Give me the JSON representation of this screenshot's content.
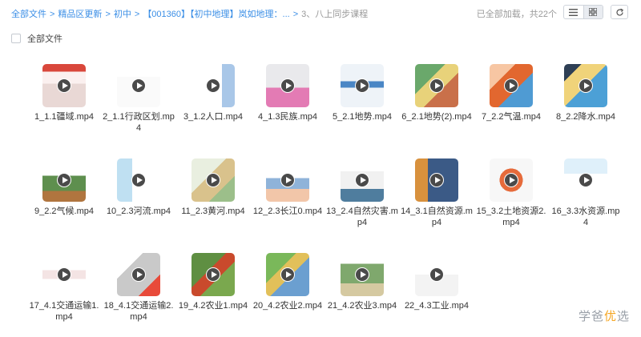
{
  "breadcrumb": {
    "items": [
      "全部文件",
      "精品区更新",
      "初中",
      "【001360】【初中地理】岚如地理：...",
      "3、八上同步课程"
    ],
    "separator": ">"
  },
  "status": {
    "loaded_text": "已全部加载，共22个"
  },
  "icons": {
    "list_view": "list-icon",
    "grid_view": "grid-icon",
    "refresh": "refresh-icon",
    "play": "play-icon"
  },
  "select_all": {
    "label": "全部文件"
  },
  "files": [
    {
      "name": "1_1.1疆域.mp4",
      "thumb": "map-red"
    },
    {
      "name": "2_1.1行政区划.mp4",
      "thumb": "white-red"
    },
    {
      "name": "3_1.2人口.mp4",
      "thumb": "slide-blue"
    },
    {
      "name": "4_1.3民族.mp4",
      "thumb": "pink-figure"
    },
    {
      "name": "5_2.1地势.mp4",
      "thumb": "table-blue"
    },
    {
      "name": "6_2.1地势(2).mp4",
      "thumb": "terrain"
    },
    {
      "name": "7_2.2气温.mp4",
      "thumb": "heat-map"
    },
    {
      "name": "8_2.2降水.mp4",
      "thumb": "rain-map"
    },
    {
      "name": "9_2.2气候.mp4",
      "thumb": "climate"
    },
    {
      "name": "10_2.3河流.mp4",
      "thumb": "rivers"
    },
    {
      "name": "11_2.3黄河.mp4",
      "thumb": "yellow-river"
    },
    {
      "name": "12_2.3长江0.mp4",
      "thumb": "yangtze"
    },
    {
      "name": "13_2.4自然灾害.mp4",
      "thumb": "disaster"
    },
    {
      "name": "14_3.1自然资源.mp4",
      "thumb": "resources"
    },
    {
      "name": "15_3.2土地资源2.mp4",
      "thumb": "pie"
    },
    {
      "name": "16_3.3水资源.mp4",
      "thumb": "water-table"
    },
    {
      "name": "17_4.1交通运输1.mp4",
      "thumb": "transport"
    },
    {
      "name": "18_4.1交通运输2.mp4",
      "thumb": "china-map"
    },
    {
      "name": "19_4.2农业1.mp4",
      "thumb": "agri-1"
    },
    {
      "name": "20_4.2农业2.mp4",
      "thumb": "agri-2"
    },
    {
      "name": "21_4.2农业3.mp4",
      "thumb": "agri-3"
    },
    {
      "name": "22_4.3工业.mp4",
      "thumb": "industry"
    }
  ],
  "watermark": {
    "text_main": "学爸",
    "text_accent": "优",
    "text_tail": "选"
  },
  "colors": {
    "link": "#3a8ee6",
    "muted": "#999999",
    "accent": "#f5a623"
  }
}
